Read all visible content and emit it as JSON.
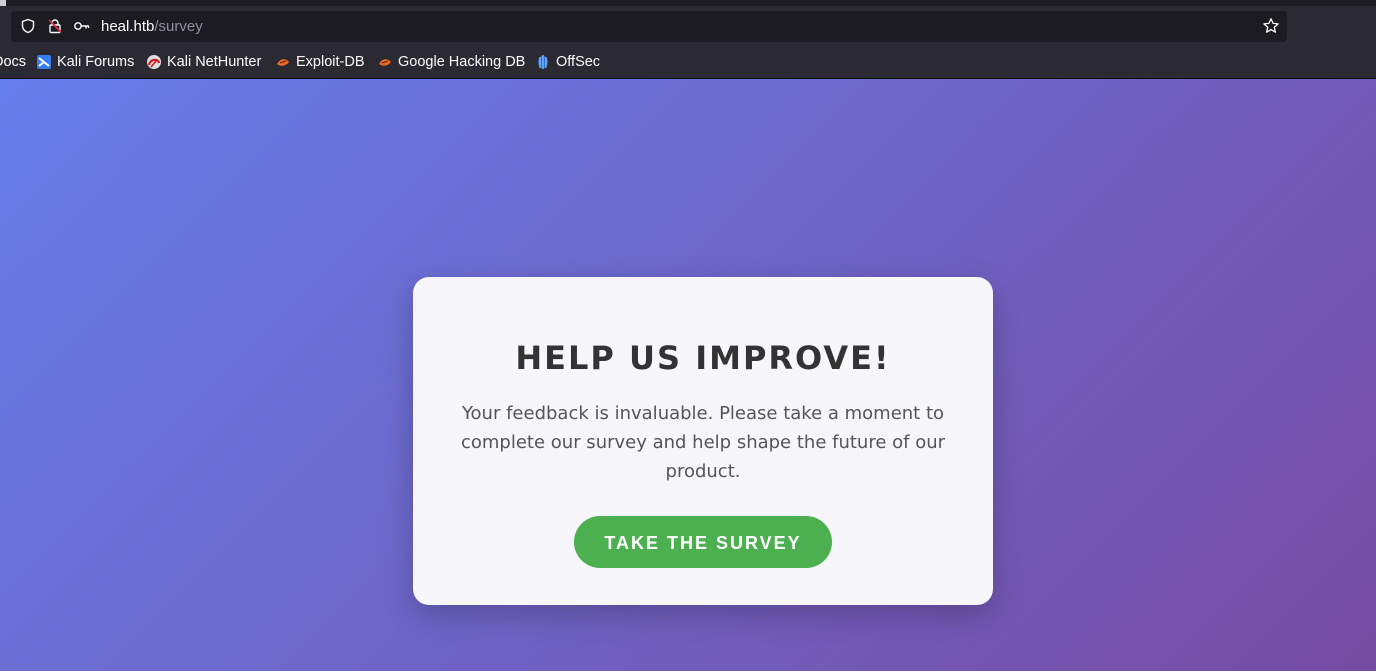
{
  "browser": {
    "url_host": "heal.htb",
    "url_path": "/survey",
    "bookmarks": [
      {
        "label": "Docs",
        "icon": "kali-docs-icon"
      },
      {
        "label": "Kali Forums",
        "icon": "kali-forums-icon"
      },
      {
        "label": "Kali NetHunter",
        "icon": "nethunter-icon"
      },
      {
        "label": "Exploit-DB",
        "icon": "exploit-db-icon"
      },
      {
        "label": "Google Hacking DB",
        "icon": "ghdb-icon"
      },
      {
        "label": "OffSec",
        "icon": "offsec-icon"
      }
    ]
  },
  "card": {
    "title": "HELP US IMPROVE!",
    "description": "Your feedback is invaluable. Please take a moment to complete our survey and help shape the future of our product.",
    "cta_label": "TAKE THE SURVEY"
  },
  "colors": {
    "gradient_start": "#667eea",
    "gradient_end": "#764ba2",
    "button": "#4caf50",
    "card_bg": "#f7f6fb"
  }
}
